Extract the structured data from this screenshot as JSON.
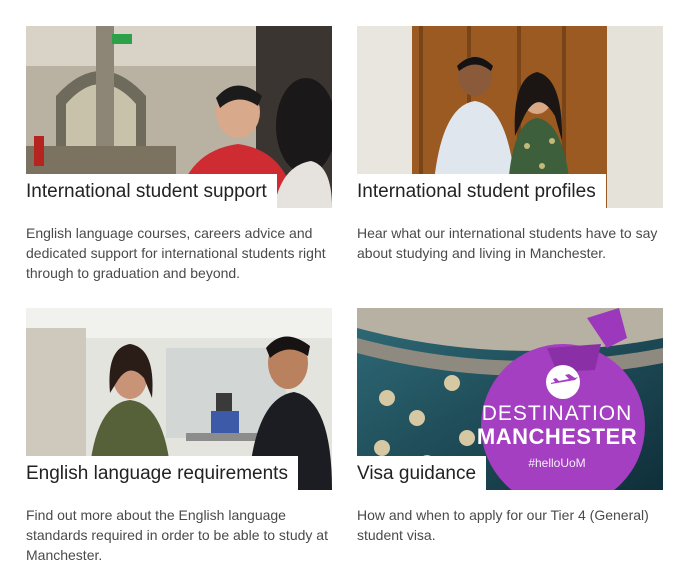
{
  "cards": [
    {
      "title": "International student support",
      "description": "English language courses, careers advice and dedicated support for international students right through to graduation and beyond."
    },
    {
      "title": "International student profiles",
      "description": "Hear what our international students have to say about studying and living in Manchester."
    },
    {
      "title": "English language requirements",
      "description": "Find out more about the English language standards required in order to be able to study at Manchester."
    },
    {
      "title": "Visa guidance",
      "description": "How and when to apply for our Tier 4 (General) student visa.",
      "tag": {
        "line1": "DESTINATION",
        "line2": "MANCHESTER",
        "hashtag": "#helloUoM"
      }
    }
  ],
  "colors": {
    "tag_purple": "#a43fc1",
    "text": "#4a4a4a",
    "title": "#222222"
  },
  "icons": [
    "airplane-icon"
  ]
}
